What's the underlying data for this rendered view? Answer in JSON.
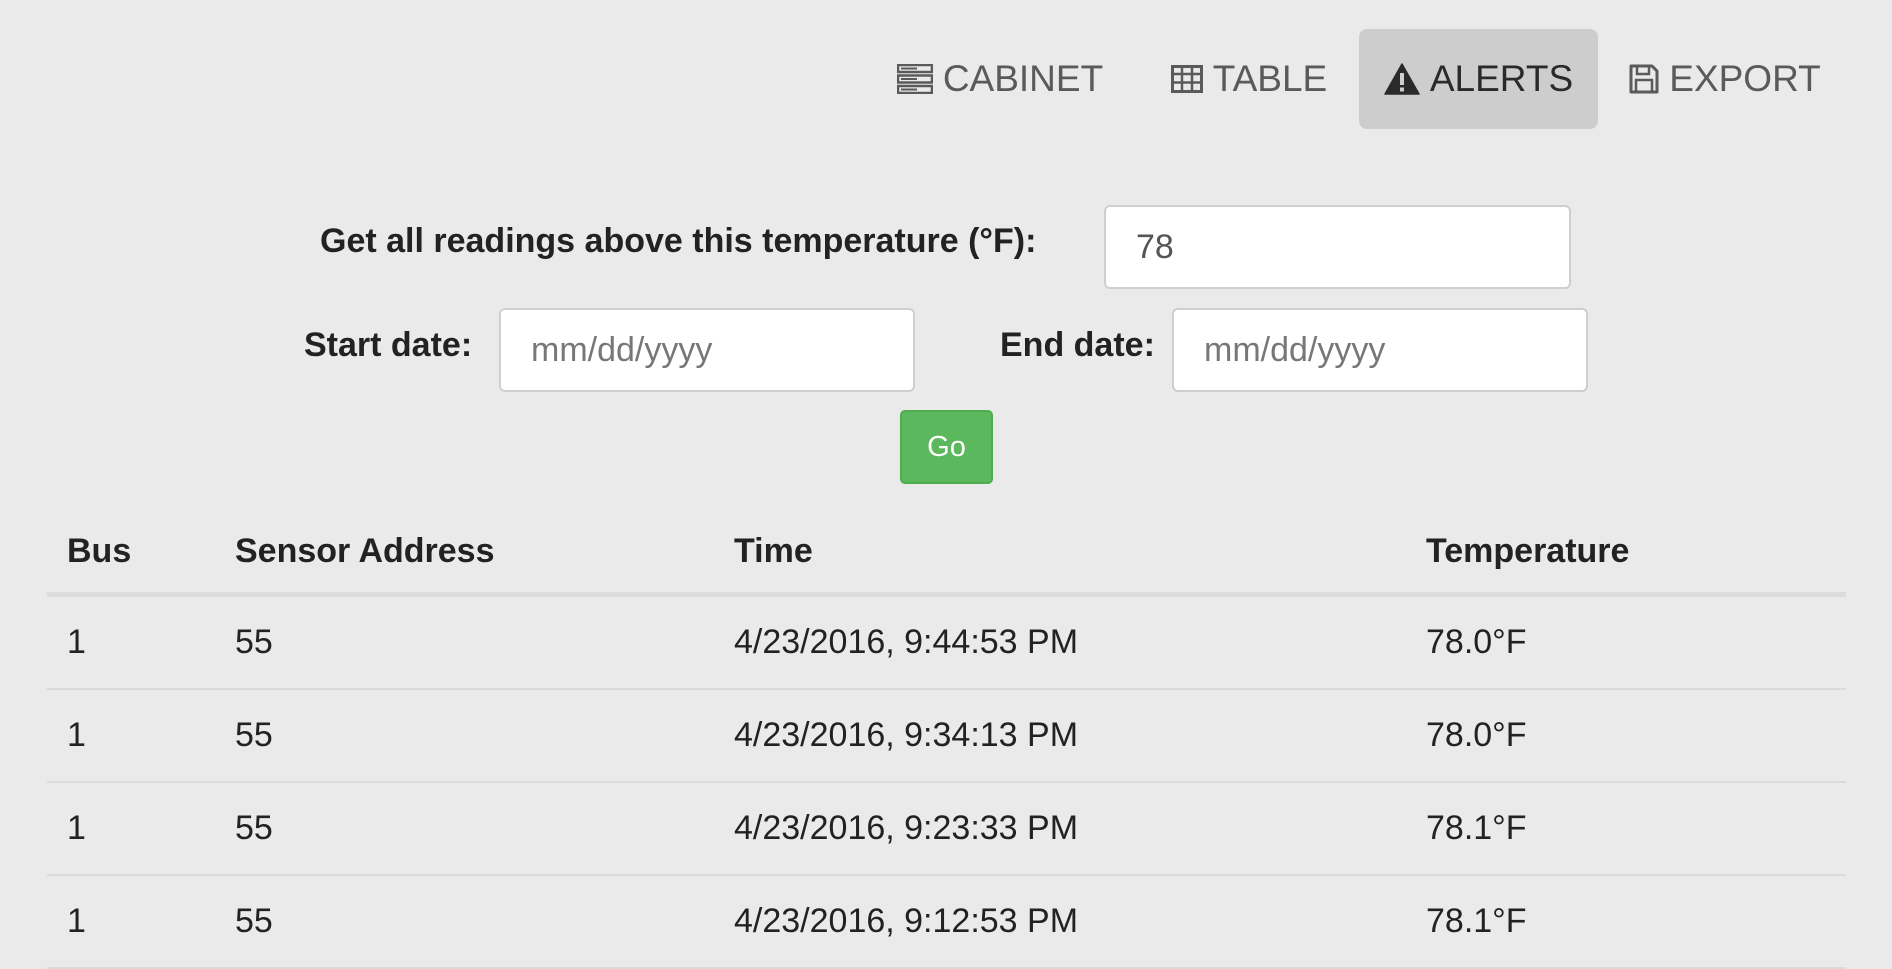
{
  "nav": {
    "items": [
      {
        "label": "CABINET",
        "icon": "server-icon"
      },
      {
        "label": "TABLE",
        "icon": "table-icon"
      },
      {
        "label": "ALERTS",
        "icon": "warning-icon",
        "active": true
      },
      {
        "label": "EXPORT",
        "icon": "floppy-disk-icon"
      }
    ]
  },
  "form": {
    "threshold_label": "Get all readings above this temperature (°F):",
    "threshold_value": "78",
    "start_label": "Start date:",
    "start_placeholder": "mm/dd/yyyy",
    "end_label": "End date:",
    "end_placeholder": "mm/dd/yyyy",
    "go_label": "Go"
  },
  "table": {
    "headers": [
      "Bus",
      "Sensor Address",
      "Time",
      "Temperature"
    ],
    "rows": [
      [
        "1",
        "55",
        "4/23/2016, 9:44:53 PM",
        "78.0°F"
      ],
      [
        "1",
        "55",
        "4/23/2016, 9:34:13 PM",
        "78.0°F"
      ],
      [
        "1",
        "55",
        "4/23/2016, 9:23:33 PM",
        "78.1°F"
      ],
      [
        "1",
        "55",
        "4/23/2016, 9:12:53 PM",
        "78.1°F"
      ]
    ]
  },
  "colors": {
    "background": "#eaeaea",
    "active_tab": "#cdcdcd",
    "go_button": "#5cb85c"
  }
}
